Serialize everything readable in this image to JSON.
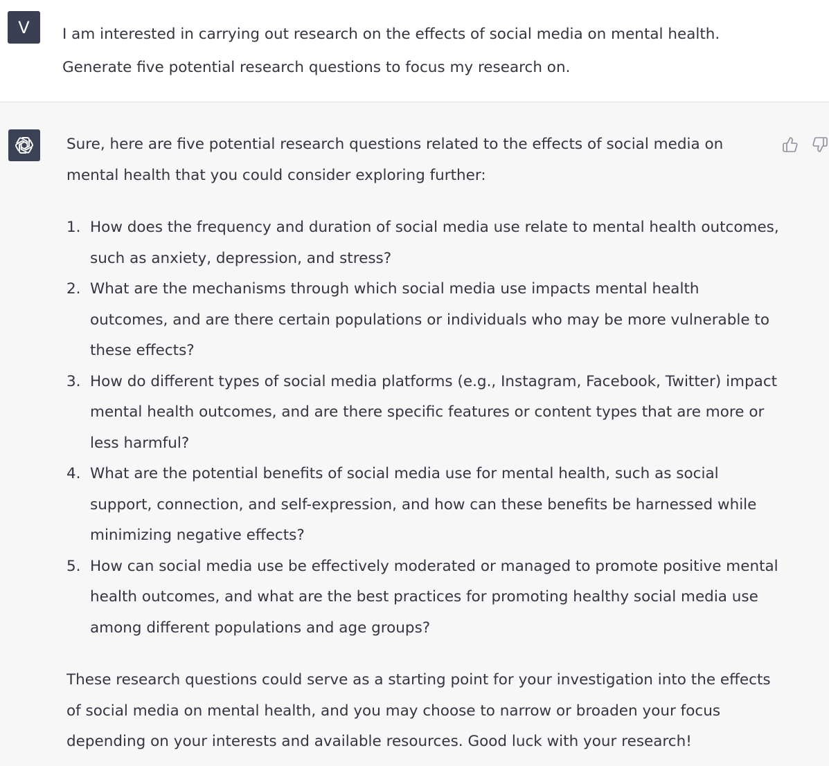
{
  "user_message": {
    "avatar_letter": "V",
    "lines": [
      "I am interested in carrying out research on the effects of social media on mental health.",
      "Generate five potential research questions to focus my research on."
    ]
  },
  "assistant_message": {
    "avatar_icon": "openai-logo-icon",
    "intro": "Sure, here are five potential research questions related to the effects of social media on mental health that you could consider exploring further:",
    "questions": [
      {
        "number": "1.",
        "text": "How does the frequency and duration of social media use relate to mental health outcomes, such as anxiety, depression, and stress?"
      },
      {
        "number": "2.",
        "text": "What are the mechanisms through which social media use impacts mental health outcomes, and are there certain populations or individuals who may be more vulnerable to these effects?"
      },
      {
        "number": "3.",
        "text": "How do different types of social media platforms (e.g., Instagram, Facebook, Twitter) impact mental health outcomes, and are there specific features or content types that are more or less harmful?"
      },
      {
        "number": "4.",
        "text": "What are the potential benefits of social media use for mental health, such as social support, connection, and self-expression, and how can these benefits be harnessed while minimizing negative effects?"
      },
      {
        "number": "5.",
        "text": "How can social media use be effectively moderated or managed to promote positive mental health outcomes, and what are the best practices for promoting healthy social media use among different populations and age groups?"
      }
    ],
    "outro": "These research questions could serve as a starting point for your investigation into the effects of social media on mental health, and you may choose to narrow or broaden your focus depending on your interests and available resources. Good luck with your research!"
  },
  "feedback": {
    "thumbs_up_icon": "thumbs-up-icon",
    "thumbs_down_icon": "thumbs-down-icon"
  },
  "colors": {
    "user_avatar_bg": "#3a3f54",
    "assistant_avatar_bg": "#3b4256",
    "assistant_row_bg": "#f7f7f8",
    "text": "#343541"
  }
}
